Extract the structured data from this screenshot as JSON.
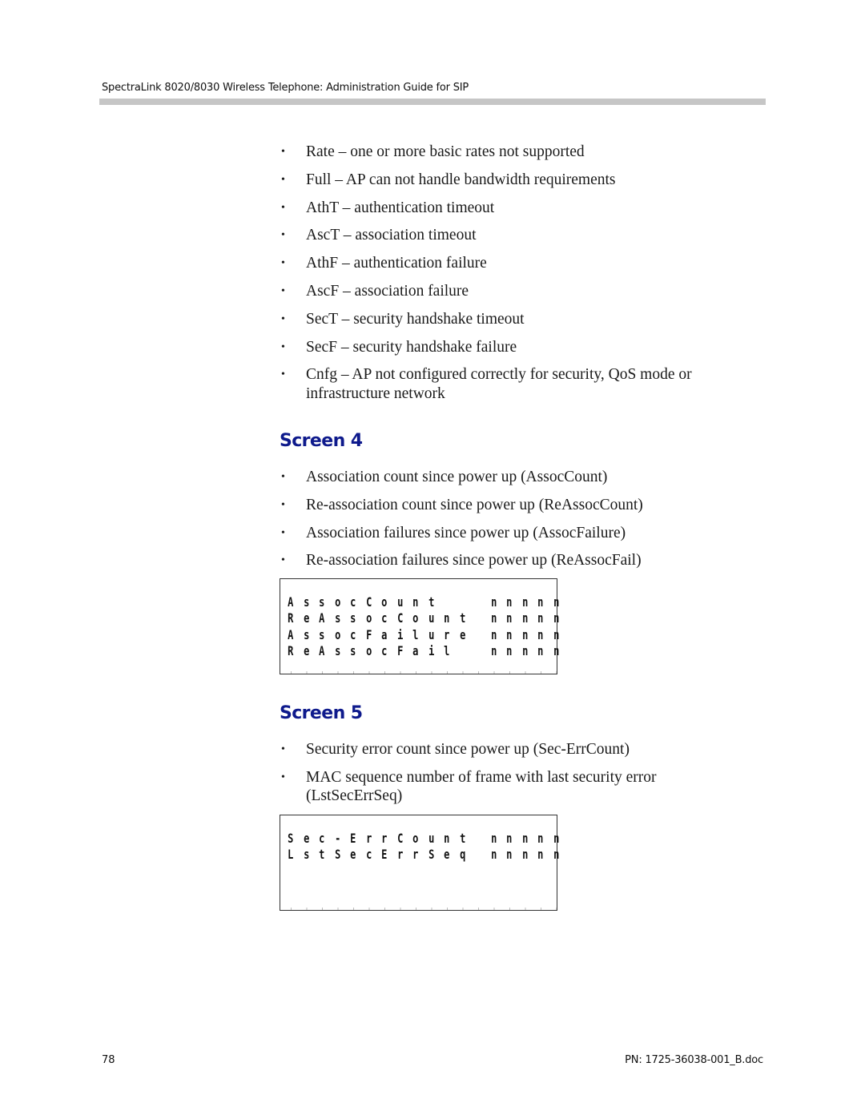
{
  "header": {
    "title": "SpectraLink 8020/8030 Wireless Telephone: Administration Guide for SIP"
  },
  "intro_bullets": [
    "Rate – one or more basic rates not supported",
    "Full – AP can not handle bandwidth requirements",
    "AthT – authentication timeout",
    "AscT – association timeout",
    "AthF – authentication failure",
    "AscF – association failure",
    "SecT – security handshake timeout",
    "SecF – security handshake failure",
    "Cnfg – AP not configured correctly for security, QoS mode or infrastructure network"
  ],
  "bullet_glyph": "•",
  "screen4": {
    "heading": "Screen 4",
    "bullets": [
      "Association count since power up (AssocCount)",
      "Re-association count since power up (ReAssocCount)",
      "Association failures since power up (AssocFailure)",
      "Re-association failures since power up (ReAssocFail)"
    ],
    "display": {
      "columns": 18,
      "rows": [
        {
          "label": "AssocCount",
          "value": "nnnnn"
        },
        {
          "label": "ReAssocCount",
          "value": "nnnnn"
        },
        {
          "label": "AssocFailure",
          "value": "nnnnn"
        },
        {
          "label": "ReAssocFail",
          "value": "nnnnn"
        }
      ]
    }
  },
  "screen5": {
    "heading": "Screen 5",
    "bullets": [
      "Security error count since power up (Sec-ErrCount)",
      "MAC sequence number of frame with last security error (LstSecErrSeq)"
    ],
    "display": {
      "columns": 18,
      "rows": [
        {
          "label": "Sec-ErrCount",
          "value": "nnnnn"
        },
        {
          "label": "LstSecErrSeq",
          "value": "nnnnn"
        }
      ]
    }
  },
  "footer": {
    "page_number": "78",
    "part_number": "PN: 1725-36038-001_B.doc"
  }
}
